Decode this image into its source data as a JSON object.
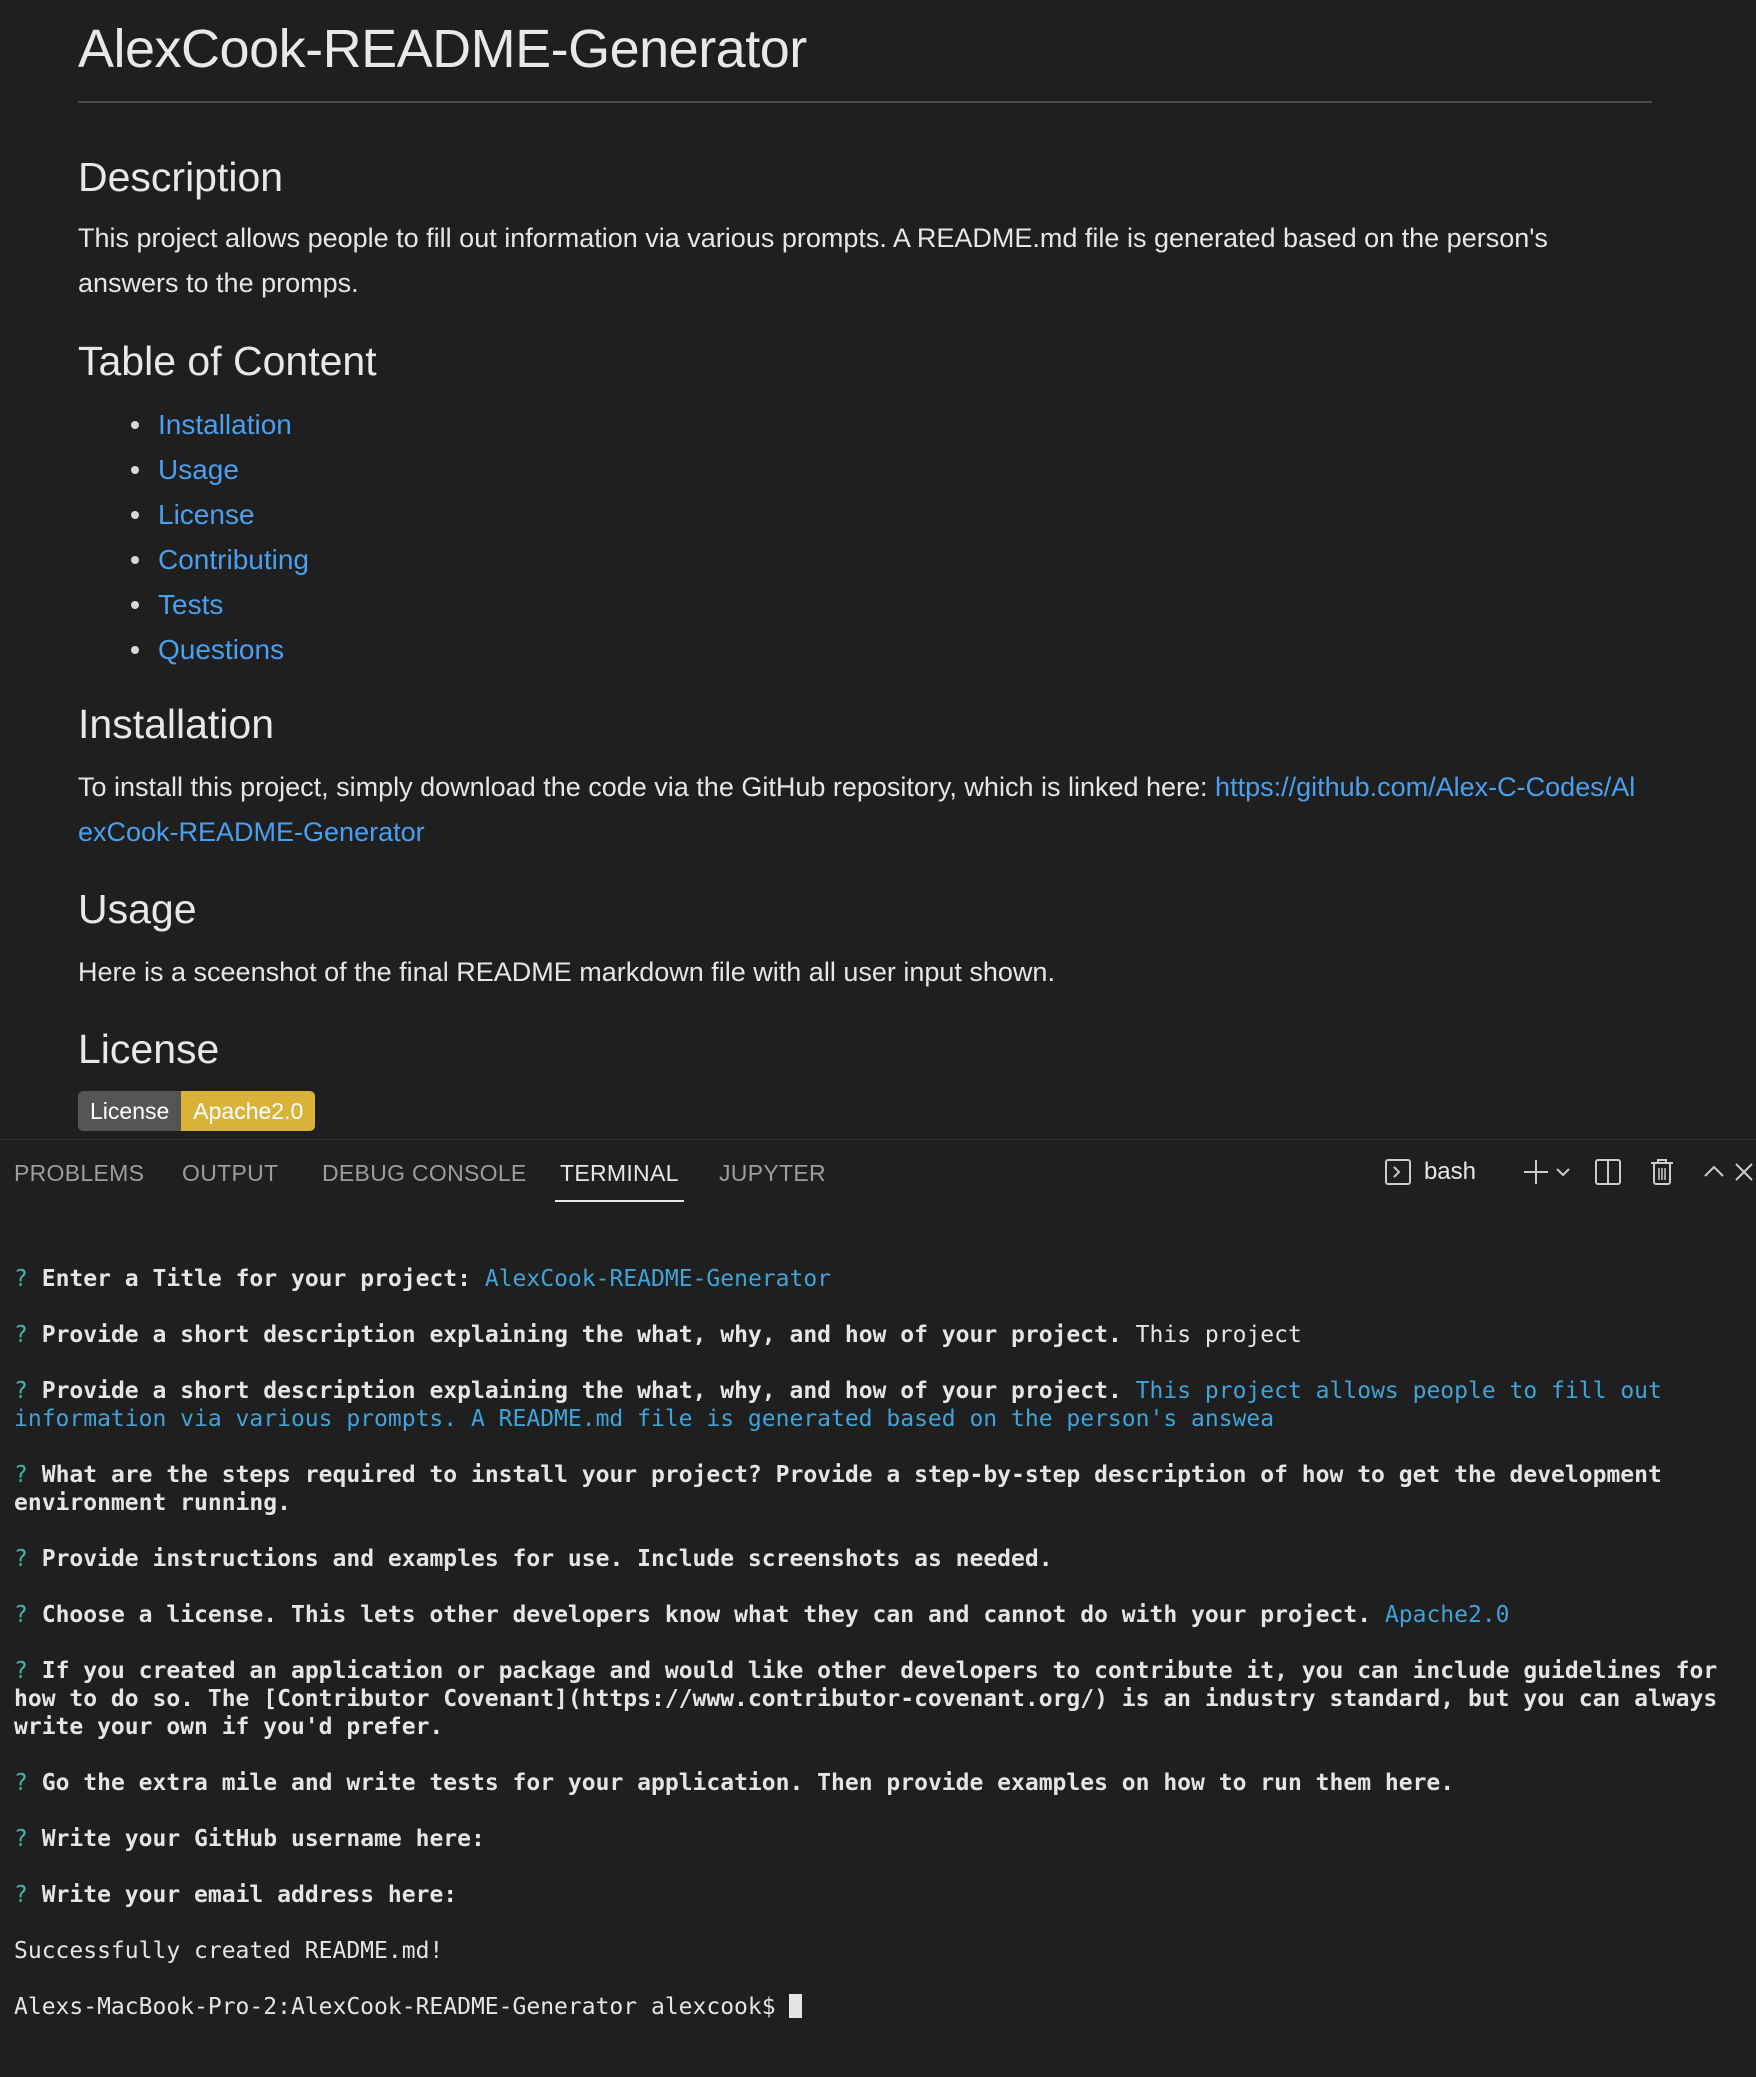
{
  "readme": {
    "title": "AlexCook-README-Generator",
    "description": {
      "heading": "Description",
      "text": "This project allows people to fill out information via various prompts. A README.md file is generated based on the person's answers to the promps."
    },
    "toc": {
      "heading": "Table of Content",
      "items": [
        "Installation",
        "Usage",
        "License",
        "Contributing",
        "Tests",
        "Questions"
      ]
    },
    "installation": {
      "heading": "Installation",
      "text": "To install this project, simply download the code via the GitHub repository, which is linked here: ",
      "link": "https://github.com/Alex-C-Codes/AlexCook-README-Generator"
    },
    "usage": {
      "heading": "Usage",
      "text": "Here is a sceenshot of the final README markdown file with all user input shown."
    },
    "license": {
      "heading": "License",
      "badge_left": "License",
      "badge_right": "Apache2.0",
      "badge_left_color": "#555555",
      "badge_right_color": "#d9b23a"
    }
  },
  "panel": {
    "tabs": [
      "PROBLEMS",
      "OUTPUT",
      "DEBUG CONSOLE",
      "TERMINAL",
      "JUPYTER"
    ],
    "active_tab": "TERMINAL",
    "shell_label": "bash",
    "icons": [
      "terminal-icon",
      "plus-icon",
      "chevron-down-icon",
      "split-icon",
      "trash-icon",
      "chevron-up-icon",
      "close-icon"
    ]
  },
  "terminal": {
    "prompt_mark": "?",
    "lines": [
      {
        "q": "Enter a Title for your project:",
        "a": "AlexCook-README-Generator",
        "a_style": "ans"
      },
      {
        "q": "Provide a short description explaining the what, why, and how of your project.",
        "a": "This project",
        "a_style": "plain"
      },
      {
        "q": "Provide a short description explaining the what, why, and how of your project.",
        "a": "This project allows people to fill out information via various prompts. A README.md file is generated based on the person's answea",
        "a_style": "ans"
      },
      {
        "q": "What are the steps required to install your project? Provide a step-by-step description of how to get the development environment running.",
        "a": "",
        "a_style": "ans"
      },
      {
        "q": "Provide instructions and examples for use. Include screenshots as needed.",
        "a": "",
        "a_style": "ans"
      },
      {
        "q": "Choose a license. This lets other developers know what they can and cannot do with your project.",
        "a": "Apache2.0",
        "a_style": "ans"
      },
      {
        "q": "If you created an application or package and would like other developers to contribute it, you can include guidelines for how to do so. The [Contributor Covenant](https://www.contributor-covenant.org/) is an industry standard, but you can always write your own if you'd prefer.",
        "a": "",
        "a_style": "ans"
      },
      {
        "q": "Go the extra mile and write tests for your application. Then provide examples on how to run them here.",
        "a": "",
        "a_style": "ans"
      },
      {
        "q": "Write your GitHub username here:",
        "a": "",
        "a_style": "ans"
      },
      {
        "q": "Write your email address here:",
        "a": "",
        "a_style": "ans"
      }
    ],
    "success": "Successfully created README.md!",
    "shell_prompt": "Alexs-MacBook-Pro-2:AlexCook-README-Generator alexcook$ "
  }
}
